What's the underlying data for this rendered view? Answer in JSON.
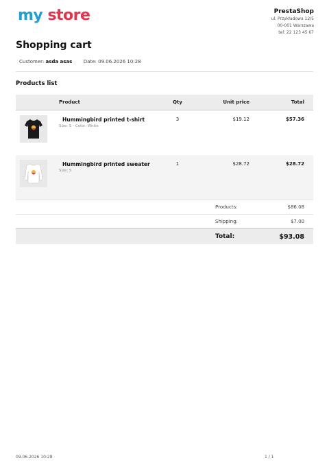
{
  "logo": {
    "part1": "my ",
    "part2": "store"
  },
  "shop": {
    "name": "PrestaShop",
    "address1": "ul. Przykładowa 12/5",
    "address2": "00-001 Warszawa",
    "phone": "tel: 22 123 45 67"
  },
  "title": "Shopping cart",
  "meta": {
    "customer_label": "Customer:",
    "customer_name": "asda asas",
    "date_label": "Date:",
    "date_value": "09.06.2026 10:28"
  },
  "section_title": "Products list",
  "table": {
    "headers": {
      "product": "Product",
      "qty": "Qty",
      "unit_price": "Unit price",
      "total": "Total"
    },
    "rows": [
      {
        "name": "Hummingbird printed t-shirt",
        "attributes": "Size: S - Color: White",
        "qty": "3",
        "unit_price": "$19.12",
        "total": "$57.36",
        "thumb_icon": "t-shirt-icon",
        "shirt_color": "#1a1a1a"
      },
      {
        "name": "Hummingbird printed sweater",
        "attributes": "Size: S",
        "qty": "1",
        "unit_price": "$28.72",
        "total": "$28.72",
        "thumb_icon": "sweater-icon",
        "shirt_color": "#ffffff"
      }
    ],
    "summary": {
      "products_label": "Products:",
      "products_value": "$86.08",
      "shipping_label": "Shipping:",
      "shipping_value": "$7.00",
      "total_label": "Total:",
      "total_value": "$93.08"
    }
  },
  "footer": {
    "date": "09.06.2026 10:28",
    "page": "1 / 1"
  },
  "colors": {
    "logo_blue": "#1f9fd6",
    "logo_red": "#e5334b",
    "header_bg": "#ececec",
    "alt_row_bg": "#f4f4f4"
  }
}
